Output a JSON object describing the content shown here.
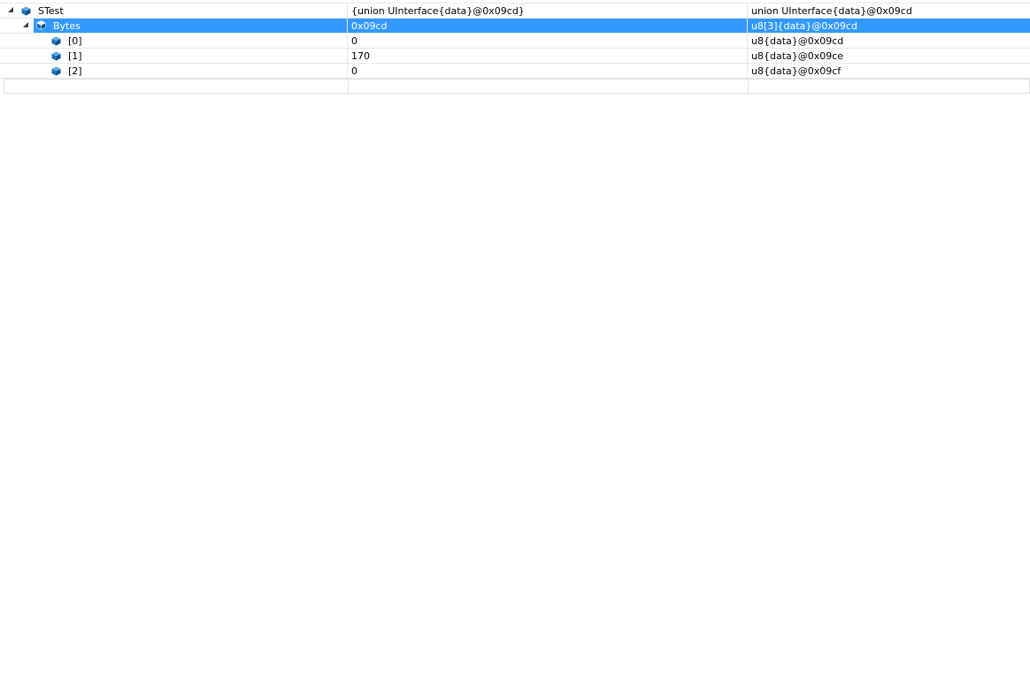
{
  "watch": {
    "rows": [
      {
        "name": "STest",
        "value": "{union UInterface{data}@0x09cd}",
        "type": "union UInterface{data}@0x09cd",
        "expanded": true,
        "selected": false
      },
      {
        "name": "Bytes",
        "value": "0x09cd",
        "type": "u8[3]{data}@0x09cd",
        "expanded": true,
        "selected": true
      },
      {
        "name": "[0]",
        "value": "0",
        "type": "u8{data}@0x09cd",
        "expanded": false,
        "selected": false
      },
      {
        "name": "[1]",
        "value": "170",
        "type": "u8{data}@0x09ce",
        "expanded": false,
        "selected": false
      },
      {
        "name": "[2]",
        "value": "0",
        "type": "u8{data}@0x09cf",
        "expanded": false,
        "selected": false
      }
    ]
  },
  "colors": {
    "selection": "#3399ff",
    "icon": "#1e6fb8"
  },
  "icons": {
    "expander": "triangle-expanded-icon",
    "variable": "object-cube-icon"
  }
}
